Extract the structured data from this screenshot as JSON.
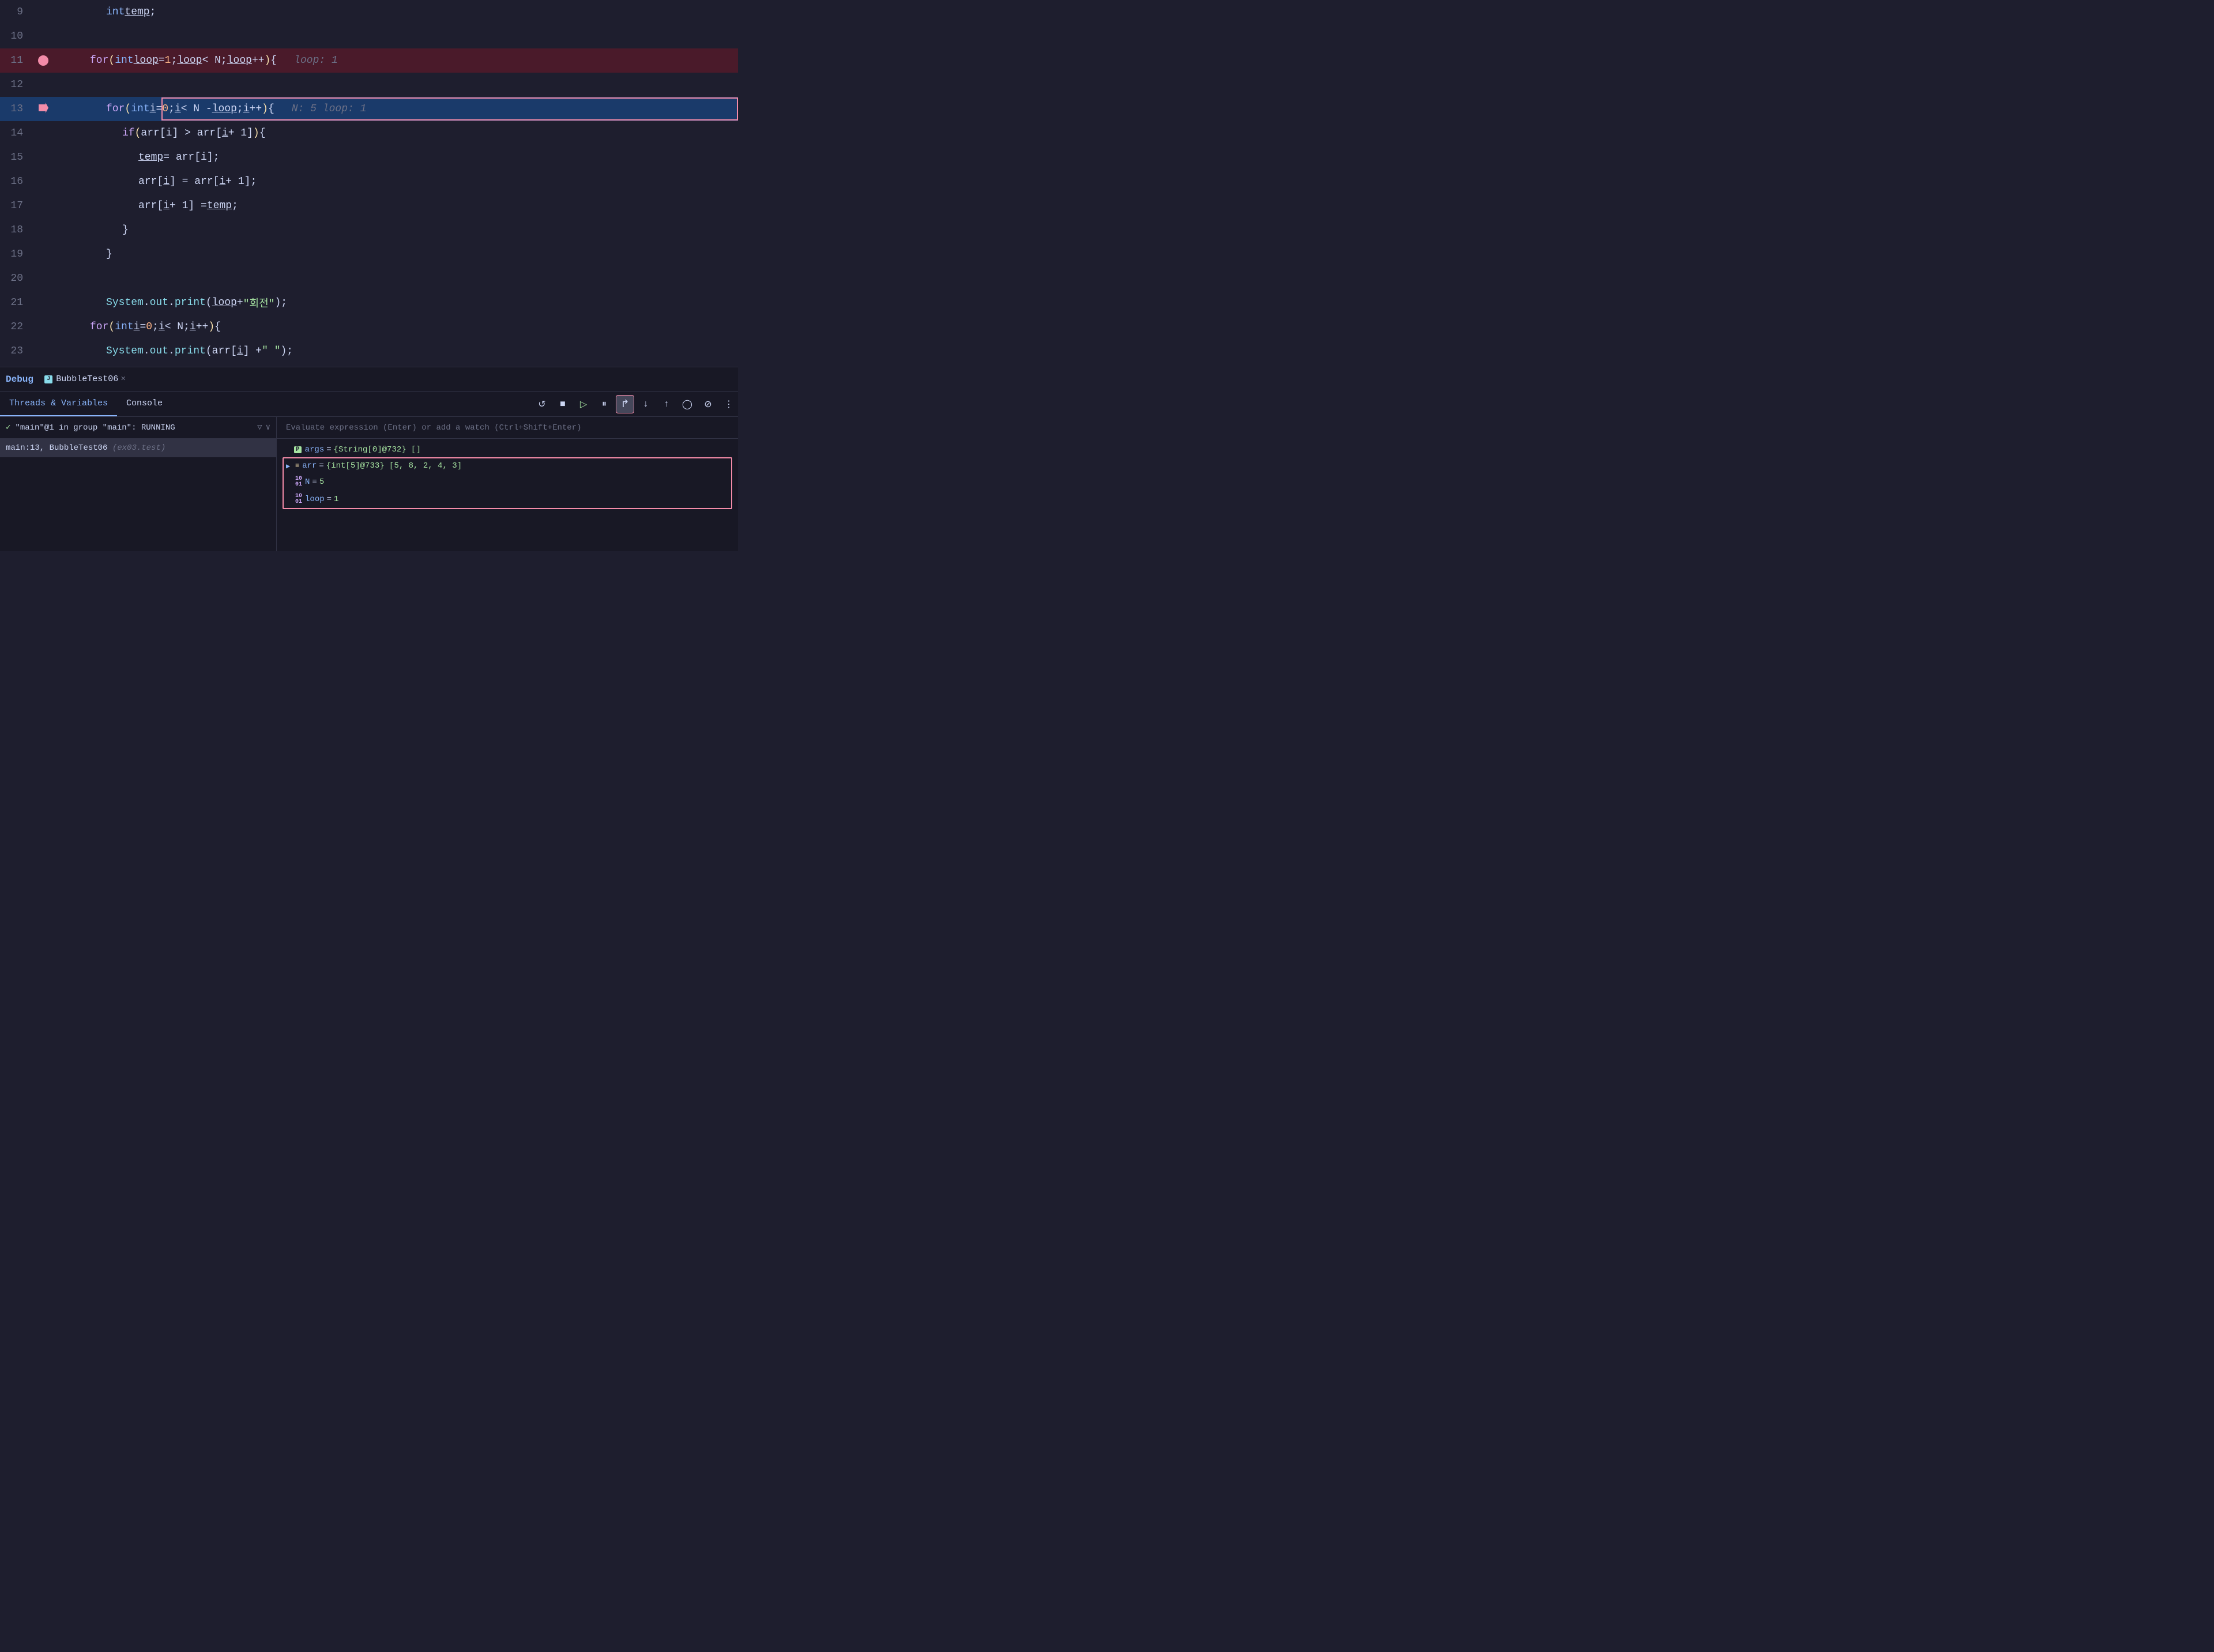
{
  "editor": {
    "lines": [
      {
        "number": "9",
        "indent": 3,
        "content_html": "<span class='type'>int</span> <span class='var underline'>temp</span>;"
      },
      {
        "number": "10",
        "indent": 3,
        "content_html": ""
      },
      {
        "number": "11",
        "indent": 2,
        "style": "highlighted-red",
        "breakpoint": true,
        "content_html": "<span class='kw'>for</span> <span class='paren'>(</span><span class='type'>int</span> <span class='var underline'>loop</span> = <span class='num'>1</span>; <span class='var underline'>loop</span> &lt; N; <span class='var underline'>loop</span>++<span class='paren'>)</span> {",
        "inline_val": "loop: 1"
      },
      {
        "number": "12",
        "indent": 3,
        "content_html": ""
      },
      {
        "number": "13",
        "indent": 3,
        "style": "highlighted-blue",
        "red_outline": true,
        "arrow": true,
        "content_html": "<span class='kw'>for</span> <span class='paren'>(</span><span class='type'>int</span> <span class='var underline'>i</span> = <span class='num'>0</span>; <span class='var underline'>i</span> &lt; N - <span class='var underline'>loop</span>; <span class='var underline'>i</span>++<span class='paren'>)</span> {",
        "inline_val": "N: 5    loop: 1"
      },
      {
        "number": "14",
        "indent": 4,
        "content_html": "<span class='kw'>if</span> <span class='paren'>(</span>arr[<span class='var'>i</span>] &gt; arr[<span class='var underline'>i</span> + 1]<span class='paren'>)</span> {"
      },
      {
        "number": "15",
        "indent": 5,
        "content_html": "<span class='var underline'>temp</span> = arr[<span class='var'>i</span>];"
      },
      {
        "number": "16",
        "indent": 5,
        "content_html": "arr[<span class='var underline'>i</span>] = arr[<span class='var underline'>i</span> + 1];"
      },
      {
        "number": "17",
        "indent": 5,
        "content_html": "arr[<span class='var underline'>i</span> + 1] = <span class='var underline'>temp</span>;"
      },
      {
        "number": "18",
        "indent": 4,
        "content_html": "}"
      },
      {
        "number": "19",
        "indent": 3,
        "content_html": "}"
      },
      {
        "number": "20",
        "indent": 3,
        "content_html": ""
      },
      {
        "number": "21",
        "indent": 3,
        "content_html": "<span class='obj'>System</span>.<span class='var obj'>out</span>.<span class='method'>print</span>(<span class='var underline'>loop</span> + <span class='str'>\"회전\"</span>);"
      },
      {
        "number": "22",
        "indent": 2,
        "content_html": "<span class='kw'>for</span> <span class='paren'>(</span><span class='type'>int</span> <span class='var underline'>i</span> = <span class='num'>0</span>; <span class='var underline'>i</span> &lt; N; <span class='var underline'>i</span>++<span class='paren'>)</span> {"
      },
      {
        "number": "23",
        "indent": 3,
        "content_html": "<span class='obj'>System</span>.<span class='var obj'>out</span>.<span class='method'>print</span>(arr[<span class='var underline'>i</span>] + <span class='str'>\" \"</span>);"
      }
    ]
  },
  "debug": {
    "label": "Debug",
    "tab_file_icon": "J",
    "tab_filename": "BubbleTest06",
    "tab_close": "×",
    "tabs": [
      {
        "id": "threads",
        "label": "Threads & Variables",
        "active": true
      },
      {
        "id": "console",
        "label": "Console",
        "active": false
      }
    ],
    "toolbar_buttons": [
      {
        "id": "restart",
        "icon": "↺",
        "highlighted": false
      },
      {
        "id": "stop",
        "icon": "■",
        "highlighted": false
      },
      {
        "id": "resume",
        "icon": "▷",
        "highlighted": false
      },
      {
        "id": "pause",
        "icon": "⏸",
        "highlighted": false
      },
      {
        "id": "step-over",
        "icon": "↱",
        "highlighted": true
      },
      {
        "id": "step-into",
        "icon": "↓",
        "highlighted": false
      },
      {
        "id": "step-out",
        "icon": "↑",
        "highlighted": false
      },
      {
        "id": "drop-frame",
        "icon": "◯",
        "highlighted": false
      },
      {
        "id": "mute-breakpoints",
        "icon": "⊘",
        "highlighted": false
      },
      {
        "id": "more",
        "icon": "⋮",
        "highlighted": false
      }
    ],
    "thread": {
      "name": "\"main\"@1 in group \"main\": RUNNING",
      "check": "✓"
    },
    "stack_frame": {
      "text": "main:13, BubbleTest06",
      "file": "(ex03.test)"
    },
    "evaluate_placeholder": "Evaluate expression (Enter) or add a watch (Ctrl+Shift+Enter)",
    "variables": [
      {
        "id": "args",
        "icon": "P",
        "expand": false,
        "name": "args",
        "value": "{String[0]@732} []",
        "in_red_box": false
      },
      {
        "id": "arr",
        "icon": "≡",
        "expand": true,
        "name": "arr",
        "value": "{int[5]@733} [5, 8, 2, 4, 3]",
        "in_red_box": true
      },
      {
        "id": "N",
        "icon": "01",
        "expand": false,
        "name": "N",
        "value": "5",
        "in_red_box": true
      },
      {
        "id": "loop",
        "icon": "01",
        "expand": false,
        "name": "loop",
        "value": "1",
        "in_red_box": true
      }
    ]
  }
}
